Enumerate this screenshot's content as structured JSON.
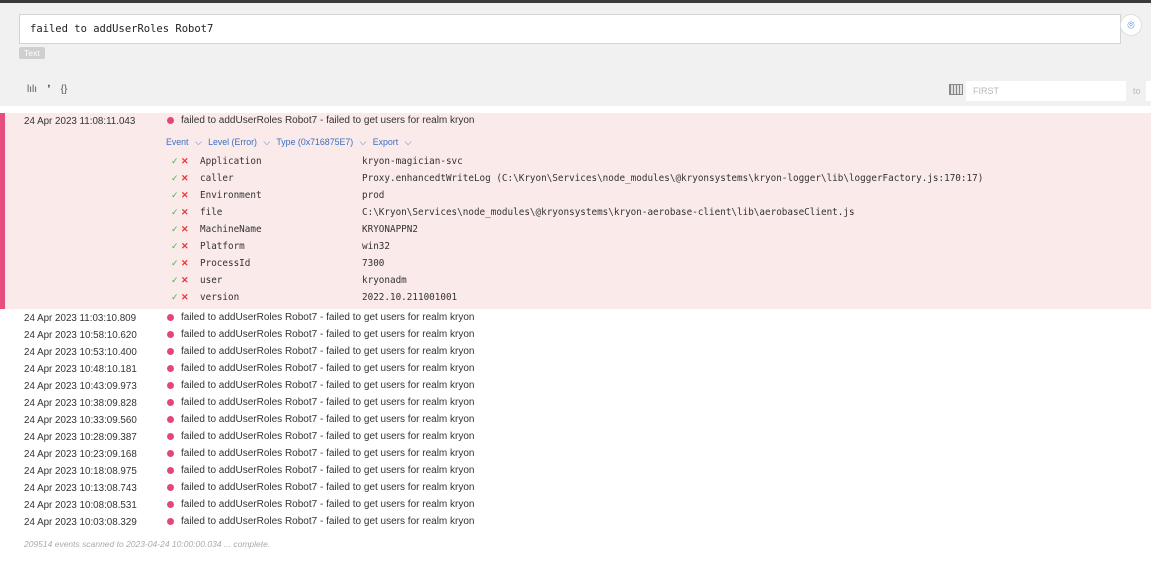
{
  "search": {
    "query": "failed to addUserRoles Robot7",
    "mode_tag": "Text"
  },
  "toolbar": {
    "chart_glyph": "lılı",
    "quote_glyph": "❜",
    "json_glyph": "{}",
    "first_placeholder": "FIRST",
    "to_label": "to"
  },
  "colors": {
    "accent": "#e54e7e",
    "expanded_bg": "#fbeaea",
    "link": "#3b6fc0",
    "check": "#4caf50",
    "exclude": "#e53935"
  },
  "expanded": {
    "timestamp": "24 Apr 2023 11:08:11.043",
    "message": "failed to addUserRoles Robot7 - failed to get users for realm kryon",
    "actions": [
      "Event",
      "Level (Error)",
      "Type (0x716875E7)",
      "Export"
    ],
    "fields": [
      {
        "key": "Application",
        "value": "kryon-magician-svc"
      },
      {
        "key": "caller",
        "value": "Proxy.enhancedtWriteLog (C:\\Kryon\\Services\\node_modules\\@kryonsystems\\kryon-logger\\lib\\loggerFactory.js:170:17)"
      },
      {
        "key": "Environment",
        "value": "prod"
      },
      {
        "key": "file",
        "value": "C:\\Kryon\\Services\\node_modules\\@kryonsystems\\kryon-aerobase-client\\lib\\aerobaseClient.js"
      },
      {
        "key": "MachineName",
        "value": "KRYONAPPN2"
      },
      {
        "key": "Platform",
        "value": "win32"
      },
      {
        "key": "ProcessId",
        "value": "7300"
      },
      {
        "key": "user",
        "value": "kryonadm"
      },
      {
        "key": "version",
        "value": "2022.10.211001001"
      }
    ]
  },
  "events": [
    {
      "timestamp": "24 Apr 2023 11:03:10.809",
      "message": "failed to addUserRoles Robot7 - failed to get users for realm kryon"
    },
    {
      "timestamp": "24 Apr 2023 10:58:10.620",
      "message": "failed to addUserRoles Robot7 - failed to get users for realm kryon"
    },
    {
      "timestamp": "24 Apr 2023 10:53:10.400",
      "message": "failed to addUserRoles Robot7 - failed to get users for realm kryon"
    },
    {
      "timestamp": "24 Apr 2023 10:48:10.181",
      "message": "failed to addUserRoles Robot7 - failed to get users for realm kryon"
    },
    {
      "timestamp": "24 Apr 2023 10:43:09.973",
      "message": "failed to addUserRoles Robot7 - failed to get users for realm kryon"
    },
    {
      "timestamp": "24 Apr 2023 10:38:09.828",
      "message": "failed to addUserRoles Robot7 - failed to get users for realm kryon"
    },
    {
      "timestamp": "24 Apr 2023 10:33:09.560",
      "message": "failed to addUserRoles Robot7 - failed to get users for realm kryon"
    },
    {
      "timestamp": "24 Apr 2023 10:28:09.387",
      "message": "failed to addUserRoles Robot7 - failed to get users for realm kryon"
    },
    {
      "timestamp": "24 Apr 2023 10:23:09.168",
      "message": "failed to addUserRoles Robot7 - failed to get users for realm kryon"
    },
    {
      "timestamp": "24 Apr 2023 10:18:08.975",
      "message": "failed to addUserRoles Robot7 - failed to get users for realm kryon"
    },
    {
      "timestamp": "24 Apr 2023 10:13:08.743",
      "message": "failed to addUserRoles Robot7 - failed to get users for realm kryon"
    },
    {
      "timestamp": "24 Apr 2023 10:08:08.531",
      "message": "failed to addUserRoles Robot7 - failed to get users for realm kryon"
    },
    {
      "timestamp": "24 Apr 2023 10:03:08.329",
      "message": "failed to addUserRoles Robot7 - failed to get users for realm kryon"
    }
  ],
  "footer": {
    "status": "209514 events scanned to 2023-04-24 10:00:00.034 ... complete."
  }
}
